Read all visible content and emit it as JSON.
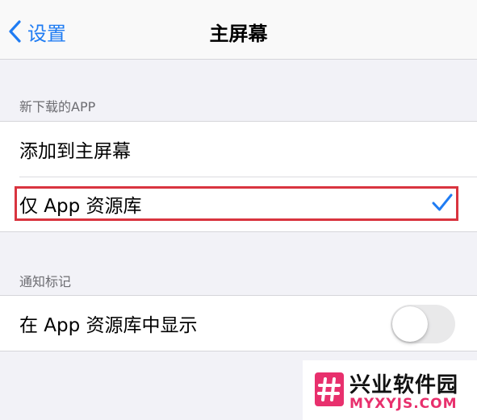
{
  "nav": {
    "back_label": "设置",
    "title": "主屏幕"
  },
  "sections": {
    "new_apps": {
      "header": "新下载的APP",
      "items": [
        {
          "label": "添加到主屏幕",
          "selected": false
        },
        {
          "label": "仅 App 资源库",
          "selected": true
        }
      ]
    },
    "badges": {
      "header": "通知标记",
      "items": [
        {
          "label": "在 App 资源库中显示",
          "toggle_on": false
        }
      ]
    }
  },
  "watermark": {
    "name": "兴业软件园",
    "url": "MYXYJS.COM",
    "logo_symbol": "#"
  },
  "colors": {
    "accent": "#1f7cf3",
    "highlight_box": "#d9343f",
    "background": "#f2f2f7",
    "watermark_pink": "#e8306d"
  }
}
